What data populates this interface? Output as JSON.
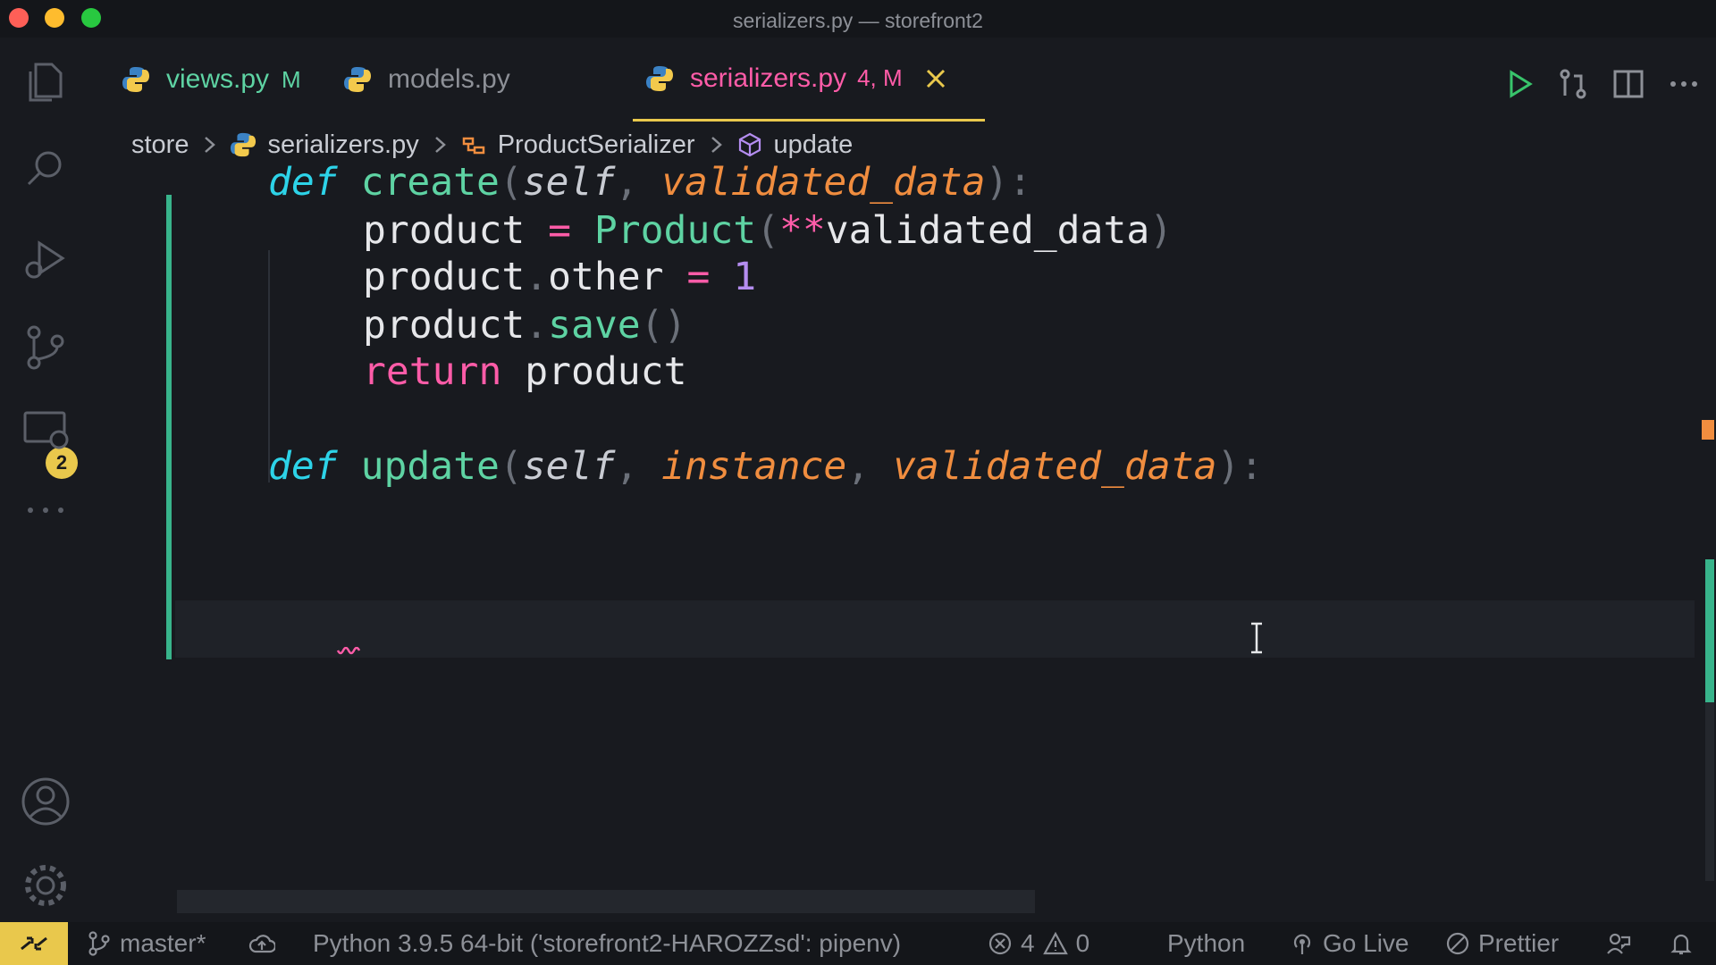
{
  "window": {
    "title": "serializers.py — storefront2"
  },
  "activity_bar": {
    "source_control_badge": "2"
  },
  "tabs": [
    {
      "label": "views.py",
      "status": "M",
      "active": false
    },
    {
      "label": "models.py",
      "status": "",
      "active": false
    },
    {
      "label": "serializers.py",
      "status": "4, M",
      "active": true
    }
  ],
  "breadcrumb": {
    "folder": "store",
    "file": "serializers.py",
    "class": "ProductSerializer",
    "method": "update"
  },
  "code": {
    "line1": {
      "kw": "def",
      "name": "create",
      "self": "self",
      "p1": "validated_data"
    },
    "line2": {
      "var": "product",
      "op": "=",
      "cls": "Product",
      "stars": "**",
      "arg": "validated_data"
    },
    "line3": {
      "obj": "product",
      "attr": "other",
      "op": "=",
      "num": "1"
    },
    "line4": {
      "obj": "product",
      "method": "save"
    },
    "line5": {
      "kw": "return",
      "var": "product"
    },
    "line6": {
      "kw": "def",
      "name": "update",
      "self": "self",
      "p1": "instance",
      "p2": "validated_data"
    }
  },
  "statusbar": {
    "branch": "master*",
    "interpreter": "Python 3.9.5 64-bit ('storefront2-HAROZZsd': pipenv)",
    "errors": "4",
    "warnings": "0",
    "language": "Python",
    "golive": "Go Live",
    "prettier": "Prettier"
  },
  "colors": {
    "accent": "#e9c84c",
    "modified_tab": "#5ed3a3",
    "active_tab_text": "#ff5ca8",
    "background": "#181a1f"
  }
}
